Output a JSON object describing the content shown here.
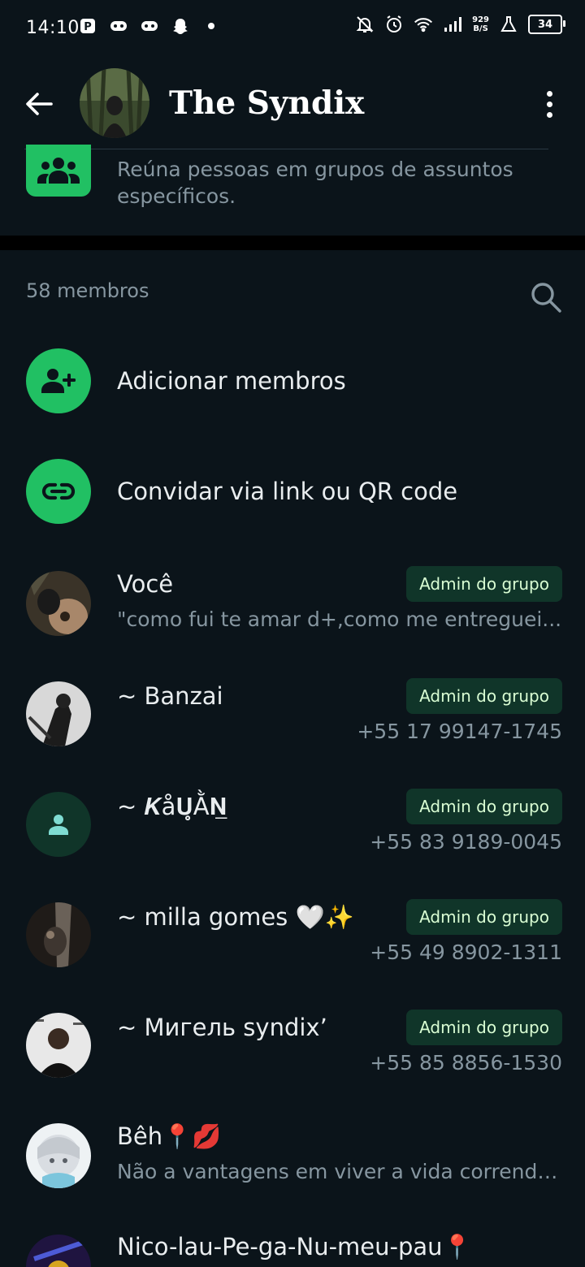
{
  "status_bar": {
    "time": "14:10",
    "left_icons": [
      "p-badge-icon",
      "gamepad-icon",
      "gamepad-icon",
      "snapchat-icon",
      "dot-icon"
    ],
    "right_icons": [
      "bell-off-icon",
      "alarm-icon",
      "wifi-icon",
      "signal-icon",
      "lab-flask-icon"
    ],
    "net_speed_value": "929",
    "net_speed_unit": "B/S",
    "battery": "34"
  },
  "header": {
    "title": "The Syndix",
    "back_icon": "arrow-left-icon",
    "menu_icon": "more-vert-icon"
  },
  "community": {
    "icon": "community-group-icon",
    "description": "Reúna pessoas em grupos de assuntos específicos."
  },
  "members": {
    "count_label": "58 membros",
    "search_icon": "search-icon",
    "actions": [
      {
        "label": "Adicionar membros",
        "icon": "person-add-icon"
      },
      {
        "label": "Convidar via link ou QR code",
        "icon": "link-icon"
      }
    ],
    "list": [
      {
        "name": "Você",
        "subtitle": "\"como fui te amar d+,como me entreguei...",
        "phone": "",
        "badge": "Admin do grupo"
      },
      {
        "name": "~ Banzai",
        "subtitle": "",
        "phone": "+55 17 99147-1745",
        "badge": "Admin do grupo"
      },
      {
        "name": "~ 𝑲å𝐔̥Ằ𝐍̲",
        "subtitle": "",
        "phone": "+55 83 9189-0045",
        "badge": "Admin do grupo"
      },
      {
        "name": "~ milla gomes 🤍✨",
        "subtitle": "",
        "phone": "+55 49 8902-1311",
        "badge": "Admin do grupo"
      },
      {
        "name": "~ Мигель          syndix’",
        "subtitle": "",
        "phone": "+55 85 8856-1530",
        "badge": "Admin do grupo"
      },
      {
        "name": "Bêh📍💋",
        "subtitle": "Não a vantagens em viver a vida correndo...",
        "phone": "",
        "badge": ""
      },
      {
        "name": "Nico-lau-Pe-ga-Nu-meu-pau📍",
        "subtitle": "",
        "phone": "",
        "badge": ""
      }
    ]
  },
  "colors": {
    "background": "#0b141a",
    "accent_green": "#21c063",
    "badge_bg": "#103529",
    "badge_text": "#d9fdd3",
    "secondary_text": "#8696a0"
  }
}
